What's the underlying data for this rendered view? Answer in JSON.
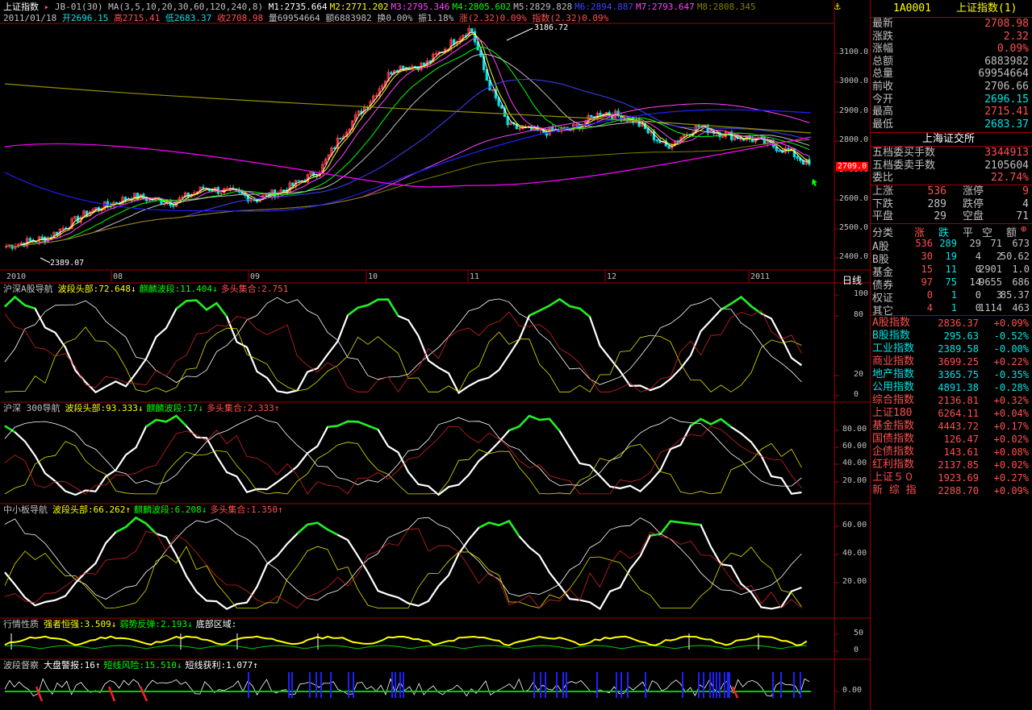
{
  "header": {
    "title": "上证指数",
    "indicator": "JB-01(30)",
    "ma_params": "MA(3,5,10,20,30,60,120,240,8)",
    "ma_values": [
      {
        "label": "M1:2735.664",
        "color": "#ffffff"
      },
      {
        "label": "M2:2771.202",
        "color": "#ffff00"
      },
      {
        "label": "M3:2795.346",
        "color": "#ff44ff"
      },
      {
        "label": "M4:2805.602",
        "color": "#00ff00"
      },
      {
        "label": "M5:2829.828",
        "color": "#c0c0c0"
      },
      {
        "label": "M6:2894.887",
        "color": "#4040ff"
      },
      {
        "label": "M7:2793.647",
        "color": "#ff44ff"
      },
      {
        "label": "M8:2808.345",
        "color": "#808000"
      }
    ],
    "date": "2011/01/18",
    "open": "开2696.15",
    "high": "高2715.41",
    "low": "低2683.37",
    "close": "收2708.98",
    "volume": "量69954664",
    "amount": "额6883982",
    "turnover": "换0.00%",
    "amplitude": "振1.18%",
    "change": "涨(2.32)0.09%",
    "index_change": "指数(2.32)0.09%"
  },
  "main_chart": {
    "price_labels": [
      "3100.0",
      "3000.0",
      "2900.0",
      "2800.0",
      "2700.0",
      "2600.0",
      "2500.0",
      "2400.0"
    ],
    "last_price_tag": "2709.0",
    "high_mark": "3186.72",
    "low_mark": "2389.07",
    "date_labels": [
      "2010",
      "08",
      "09",
      "10",
      "11",
      "12",
      "2011"
    ],
    "period": "日线"
  },
  "panels": [
    {
      "title": "沪深A股导航",
      "items": [
        {
          "text": "波段头部:72.648↓",
          "color": "#ffff00"
        },
        {
          "text": "麒麟波段:11.404↓",
          "color": "#00ff00"
        },
        {
          "text": "多头集合:2.751",
          "color": "#ff5050"
        }
      ],
      "axis": [
        "100",
        "80",
        "20",
        "0"
      ]
    },
    {
      "title": "沪深 300导航",
      "items": [
        {
          "text": "波段头部:93.333↓",
          "color": "#ffff00"
        },
        {
          "text": "麒麟波段:17↓",
          "color": "#00ff00"
        },
        {
          "text": "多头集合:2.333↑",
          "color": "#ff5050"
        }
      ],
      "axis": [
        "80.00",
        "60.00",
        "40.00",
        "20.00"
      ]
    },
    {
      "title": "中小板导航",
      "items": [
        {
          "text": "波段头部:66.262↑",
          "color": "#ffff00"
        },
        {
          "text": "麒麟波段:6.208↓",
          "color": "#00ff00"
        },
        {
          "text": "多头集合:1.350↑",
          "color": "#ff5050"
        }
      ],
      "axis": [
        "60.00",
        "40.00",
        "20.00"
      ]
    },
    {
      "title": "行情性质",
      "items": [
        {
          "text": "强者恒强:3.509↓",
          "color": "#ffff00"
        },
        {
          "text": "弱势反弹:2.193↓",
          "color": "#00ff00"
        },
        {
          "text": "底部区域:",
          "color": "#ffffff"
        }
      ],
      "axis": [
        "50",
        "0"
      ]
    },
    {
      "title": "波段督察",
      "items": [
        {
          "text": "大盘警报:16↑",
          "color": "#ffffff"
        },
        {
          "text": "短线风险:15.510↓",
          "color": "#00ff00"
        },
        {
          "text": "短线获利:1.077↑",
          "color": "#ffffff"
        }
      ],
      "axis": [
        "0.00"
      ]
    }
  ],
  "sidebar": {
    "code": "1A0001",
    "name": "上证指数(1)",
    "quote": [
      {
        "k": "最新",
        "v": "2708.98",
        "c": "#ff5050"
      },
      {
        "k": "涨跌",
        "v": "2.32",
        "c": "#ff5050"
      },
      {
        "k": "涨幅",
        "v": "0.09%",
        "c": "#ff5050"
      },
      {
        "k": "总额",
        "v": "6883982",
        "c": "#c0c0c0"
      },
      {
        "k": "总量",
        "v": "69954664",
        "c": "#c0c0c0"
      },
      {
        "k": "前收",
        "v": "2706.66",
        "c": "#c0c0c0"
      },
      {
        "k": "今开",
        "v": "2696.15",
        "c": "#00e5e5"
      },
      {
        "k": "最高",
        "v": "2715.41",
        "c": "#ff5050"
      },
      {
        "k": "最低",
        "v": "2683.37",
        "c": "#00e5e5"
      }
    ],
    "exchange": "上海证交所",
    "depth": [
      {
        "k": "五档委买手数",
        "v": "3344913",
        "c": "#ff5050"
      },
      {
        "k": "五档委卖手数",
        "v": "2105604",
        "c": "#c0c0c0"
      },
      {
        "k": "委比",
        "v": "22.74%",
        "c": "#ff5050"
      }
    ],
    "breadth": [
      {
        "k1": "上涨",
        "v1": "536",
        "k2": "涨停",
        "v2": "9"
      },
      {
        "k1": "下跌",
        "v1": "289",
        "k2": "跌停",
        "v2": "4"
      },
      {
        "k1": "平盘",
        "v1": "29",
        "k2": "空盘",
        "v2": "71"
      }
    ],
    "table_header": [
      "分类",
      "涨",
      "跌",
      "平",
      "空",
      "额"
    ],
    "table_rows": [
      [
        "A股",
        "536",
        "289",
        "29",
        "71",
        "673"
      ],
      [
        "B股",
        "30",
        "19",
        "4",
        "2",
        "50.62"
      ],
      [
        "基金",
        "15",
        "11",
        "0",
        "2901",
        "1.0"
      ],
      [
        "债券",
        "97",
        "75",
        "14",
        "9655",
        "686"
      ],
      [
        "权证",
        "0",
        "1",
        "0",
        "3",
        "85.37"
      ],
      [
        "其它",
        "4",
        "1",
        "0",
        "1114",
        "463"
      ]
    ],
    "indices": [
      {
        "name": "A股指数",
        "value": "2836.37",
        "pct": "+0.09%"
      },
      {
        "name": "B股指数",
        "value": "295.63",
        "pct": "-0.52%"
      },
      {
        "name": "工业指数",
        "value": "2389.58",
        "pct": "-0.00%"
      },
      {
        "name": "商业指数",
        "value": "3699.25",
        "pct": "+0.22%"
      },
      {
        "name": "地产指数",
        "value": "3365.75",
        "pct": "-0.35%"
      },
      {
        "name": "公用指数",
        "value": "4891.38",
        "pct": "-0.28%"
      },
      {
        "name": "综合指数",
        "value": "2136.81",
        "pct": "+0.32%"
      },
      {
        "name": "上证180",
        "value": "6264.11",
        "pct": "+0.04%"
      },
      {
        "name": "基金指数",
        "value": "4443.72",
        "pct": "+0.17%"
      },
      {
        "name": "国债指数",
        "value": "126.47",
        "pct": "+0.02%"
      },
      {
        "name": "企债指数",
        "value": "143.61",
        "pct": "+0.08%"
      },
      {
        "name": "红利指数",
        "value": "2137.85",
        "pct": "+0.02%"
      },
      {
        "name": "上证５０",
        "value": "1923.69",
        "pct": "+0.27%"
      },
      {
        "name": "新 综 指",
        "value": "2288.70",
        "pct": "+0.09%"
      }
    ]
  },
  "colors": {
    "up": "#ff5050",
    "down": "#00e5e5",
    "border": "#a00000",
    "bg": "#000000"
  }
}
